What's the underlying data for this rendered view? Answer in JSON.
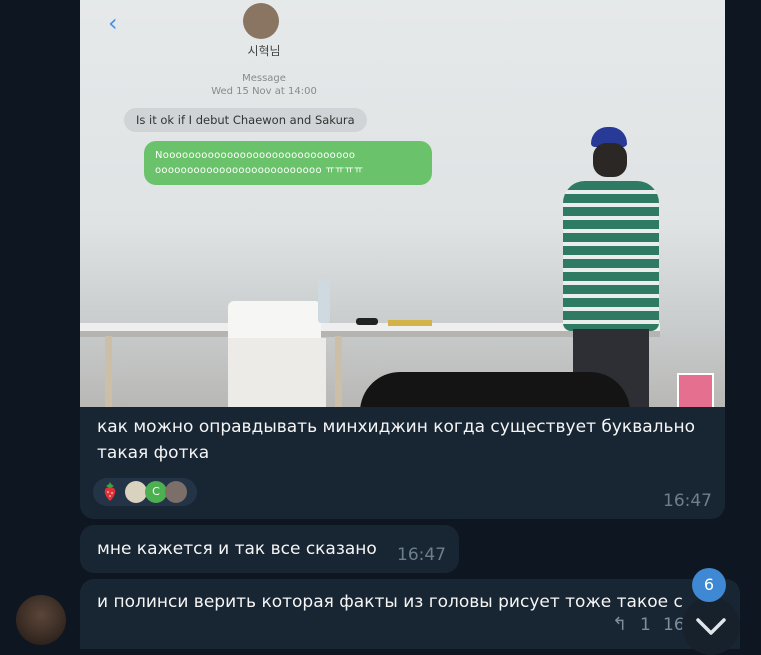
{
  "screenshot": {
    "contact_name": "시혁님",
    "meta_label": "Message",
    "meta_date": "Wed 15 Nov at 14:00",
    "incoming": "Is it ok if I debut Chaewon and Sakura",
    "outgoing": "Noooooooooooooooooooooooooooooo oooooooooooooooooooooooooo ㅠㅠㅠㅠ"
  },
  "messages": [
    {
      "text": "как можно оправдывать минхиджин когда существует буквально такая фотка",
      "time": "16:47"
    },
    {
      "text": "мне кажется и так все сказано",
      "time": "16:47"
    },
    {
      "text": "и полинси верить которая факты из головы рисует тоже такое с",
      "time": "16"
    }
  ],
  "reactions": {
    "icons": [
      "strawberry-icon",
      "reaction-avatar-1",
      "reaction-avatar-2",
      "reaction-avatar-3"
    ],
    "letter": "C"
  },
  "footer": {
    "reply_count": "1",
    "unread_badge": "6",
    "icons": [
      "reply-icon",
      "chevron-down-icon"
    ]
  },
  "colors": {
    "background": "#0e1621",
    "bubble": "#182533",
    "accent": "#3e88d4",
    "timestamp": "#6d7f8f"
  }
}
